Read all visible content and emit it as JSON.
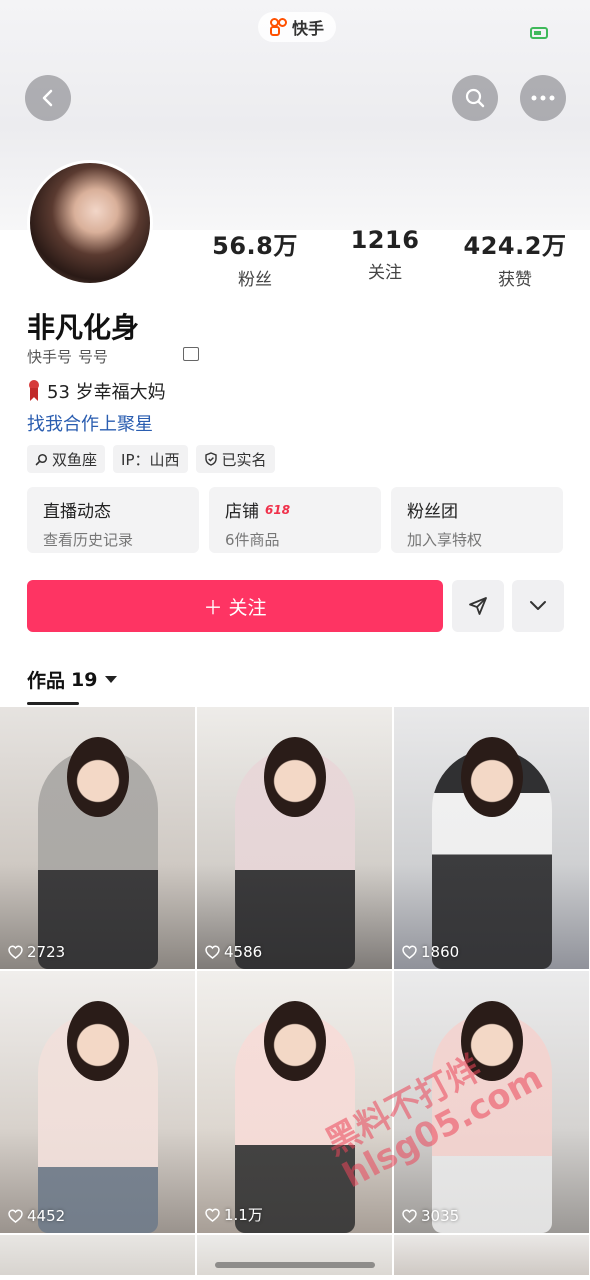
{
  "app": {
    "name": "快手"
  },
  "profile": {
    "nickname": "非凡化身",
    "account_label": "快手号",
    "account_value": "号号",
    "bio_line1": "53 岁幸福大妈",
    "bio_line2": "找我合作上聚星"
  },
  "stats": [
    {
      "value": "56.8万",
      "label": "粉丝"
    },
    {
      "value": "1216",
      "label": "关注"
    },
    {
      "value": "424.2万",
      "label": "获赞"
    }
  ],
  "tags": [
    {
      "icon": "search-icon",
      "text": "双鱼座"
    },
    {
      "icon": "",
      "text": "IP：山西"
    },
    {
      "icon": "shield-icon",
      "text": "已实名"
    }
  ],
  "cards": [
    {
      "title": "直播动态",
      "badge": "",
      "subtitle": "查看历史记录"
    },
    {
      "title": "店铺",
      "badge": "618",
      "subtitle": "6件商品"
    },
    {
      "title": "粉丝团",
      "badge": "",
      "subtitle": "加入享特权"
    }
  ],
  "actions": {
    "follow_label": "＋ 关注"
  },
  "works": {
    "tab_label": "作品",
    "count": "19",
    "items": [
      {
        "likes": "2723"
      },
      {
        "likes": "4586"
      },
      {
        "likes": "1860"
      },
      {
        "likes": "4452"
      },
      {
        "likes": "1.1万"
      },
      {
        "likes": "3035"
      }
    ]
  },
  "watermark": {
    "line1": "黑料不打烊",
    "line2": "hlsg05.com"
  },
  "colors": {
    "follow": "#fe3463",
    "link": "#2a5db0",
    "brand": "#ff5000"
  }
}
